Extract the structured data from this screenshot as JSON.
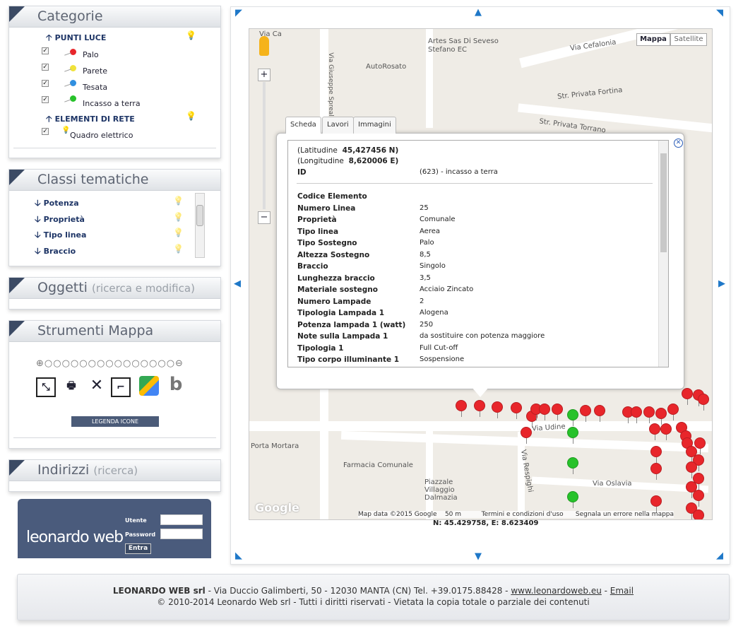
{
  "categorie": {
    "title": "Categorie",
    "group1": "PUNTI LUCE",
    "items1": [
      "Palo",
      "Parete",
      "Tesata",
      "Incasso a terra"
    ],
    "group2": "ELEMENTI DI RETE",
    "items2": [
      "Quadro elettrico"
    ]
  },
  "classi": {
    "title": "Classi tematiche",
    "items": [
      "Potenza",
      "Proprietà",
      "Tipo linea",
      "Braccio"
    ]
  },
  "oggetti": {
    "title": "Oggetti",
    "sub": "(ricerca e modifica)"
  },
  "strumenti": {
    "title": "Strumenti Mappa",
    "legend_button": "LEGENDA ICONE"
  },
  "indirizzi": {
    "title": "Indirizzi",
    "sub": "(ricerca)"
  },
  "login": {
    "logo": "leonardo web",
    "user_label": "Utente",
    "password_label": "Password",
    "button": "Entra"
  },
  "map": {
    "type_map": "Mappa",
    "type_satellite": "Satellite",
    "labels": {
      "street1": "Via Cefalonia",
      "street2": "Str. Privata Fortina",
      "street3": "Str. Privata Torrano",
      "poi1": "Artes Sas Di Seveso Stefano EC",
      "poi2": "AutoRosato",
      "poi3": "Porta Mortara",
      "poi4": "Farmacia Comunale",
      "poi5": "Piazzale Villaggio Dalmazia",
      "street4": "Via Oslavia",
      "street5": "Via Udine",
      "street6": "Via Respighi",
      "street7": "Via Giuseppe Sprealico",
      "street8": "Via Ca"
    },
    "attribution": "Map data ©2015 Google",
    "scale": "50 m",
    "terms": "Termini e condizioni d'uso",
    "report": "Segnala un errore nella mappa",
    "google": "Google",
    "coords": "N: 45.429758, E: 8.623409"
  },
  "popup": {
    "tabs": [
      "Scheda",
      "Lavori",
      "Immagini"
    ],
    "lat_label": "(Latitudine",
    "lat_value": "45,427456 N)",
    "lon_label": "(Longitudine",
    "lon_value": "8,620006 E)",
    "id_label": "ID",
    "id_value": "(623) - incasso a terra",
    "rows": [
      {
        "label": "Codice Elemento",
        "value": ""
      },
      {
        "label": "Numero Linea",
        "value": "25"
      },
      {
        "label": "Proprietà",
        "value": "Comunale"
      },
      {
        "label": "Tipo linea",
        "value": "Aerea"
      },
      {
        "label": "Tipo Sostegno",
        "value": "Palo"
      },
      {
        "label": "Altezza Sostegno",
        "value": "8,5"
      },
      {
        "label": "Braccio",
        "value": "Singolo"
      },
      {
        "label": "Lunghezza braccio",
        "value": "3,5"
      },
      {
        "label": "Materiale sostegno",
        "value": "Acciaio Zincato"
      },
      {
        "label": "Numero Lampade",
        "value": "2"
      },
      {
        "label": "Tipologia Lampada 1",
        "value": "Alogena"
      },
      {
        "label": "Potenza lampada 1 (watt)",
        "value": "250"
      },
      {
        "label": "Note sulla Lampada 1",
        "value": "da sostituire con potenza maggiore"
      },
      {
        "label": "Tipologia 1",
        "value": "Full Cut-off"
      },
      {
        "label": "Tipo corpo illuminante 1",
        "value": "Sospensione"
      }
    ]
  },
  "footer": {
    "company": "LEONARDO WEB srl",
    "address": " - Via Duccio Galimberti, 50 - 12030 MANTA (CN) Tel. +39.0175.88428 - ",
    "site": "www.leonardoweb.eu",
    "sep": " - ",
    "email": "Email",
    "copyright": "© 2010-2014 Leonardo Web srl - Tutti i diritti riservati - Vietata la copia totale o parziale dei contenuti"
  },
  "colors": {
    "accent": "#3b4a64",
    "red_pin": "#e8262b",
    "green_pin": "#27c22a"
  }
}
